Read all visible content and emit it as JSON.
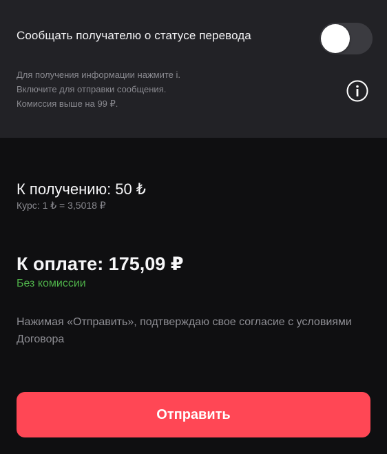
{
  "notification": {
    "title": "Сообщать получателю о статусе перевода",
    "toggle_on": false,
    "hint_lines": [
      "Для получения информации нажмите i.",
      "Включите для отправки сообщения.",
      "Комиссия выше на 99 ₽."
    ],
    "info_icon": "info-circle-icon"
  },
  "summary": {
    "receive_amount": "К получению: 50 ₺",
    "rate": "Курс: 1 ₺ = 3,5018 ₽",
    "pay_amount": "К оплате: 175,09 ₽",
    "fee_note": "Без комиссии",
    "consent_text": "Нажимая «Отправить», подтверждаю свое согласие с условиями Договора"
  },
  "actions": {
    "send_label": "Отправить"
  },
  "colors": {
    "background": "#0f0f11",
    "card": "#222226",
    "accent_button": "#ff4755",
    "fee_green": "#4fb24a",
    "muted_text": "#8a8a90"
  }
}
